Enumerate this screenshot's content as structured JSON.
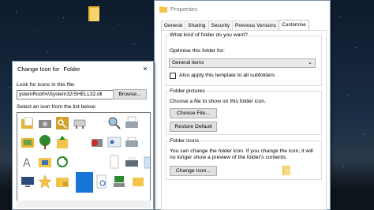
{
  "change_icon_dialog": {
    "title": "Change Icon for",
    "title_folder": "Folder",
    "close_glyph": "×",
    "look_label": "Look for icons in this file:",
    "path_value": "ystemRoot%\\System32\\SHELL32.dll",
    "browse_label": "Browse...",
    "select_label": "Select an icon from the list below:"
  },
  "properties_dialog": {
    "title": "Properties",
    "tabs": [
      "General",
      "Sharing",
      "Security",
      "Previous Versions",
      "Customise"
    ],
    "active_tab": "Customise",
    "optimise_question": "What kind of folder do you want?",
    "optimise_label": "Optimise this folder for:",
    "optimise_value": "General items",
    "apply_subfolders_label": "Also apply this template to all subfolders",
    "pictures_header": "Folder pictures",
    "pictures_desc": "Choose a file to show on this folder icon.",
    "choose_file_label": "Choose File...",
    "restore_default_label": "Restore Default",
    "icons_header": "Folder icons",
    "icons_desc_1": "You can change the folder icon. If you change the icon, it will",
    "icons_desc_2": "no longer show a preview of the folder's contents.",
    "change_icon_label": "Change Icon..."
  },
  "colors": {
    "folder_yellow": "#f3c44a",
    "selected_icon_blue": "#1874d6",
    "dialog_border": "#7a8fa8"
  }
}
